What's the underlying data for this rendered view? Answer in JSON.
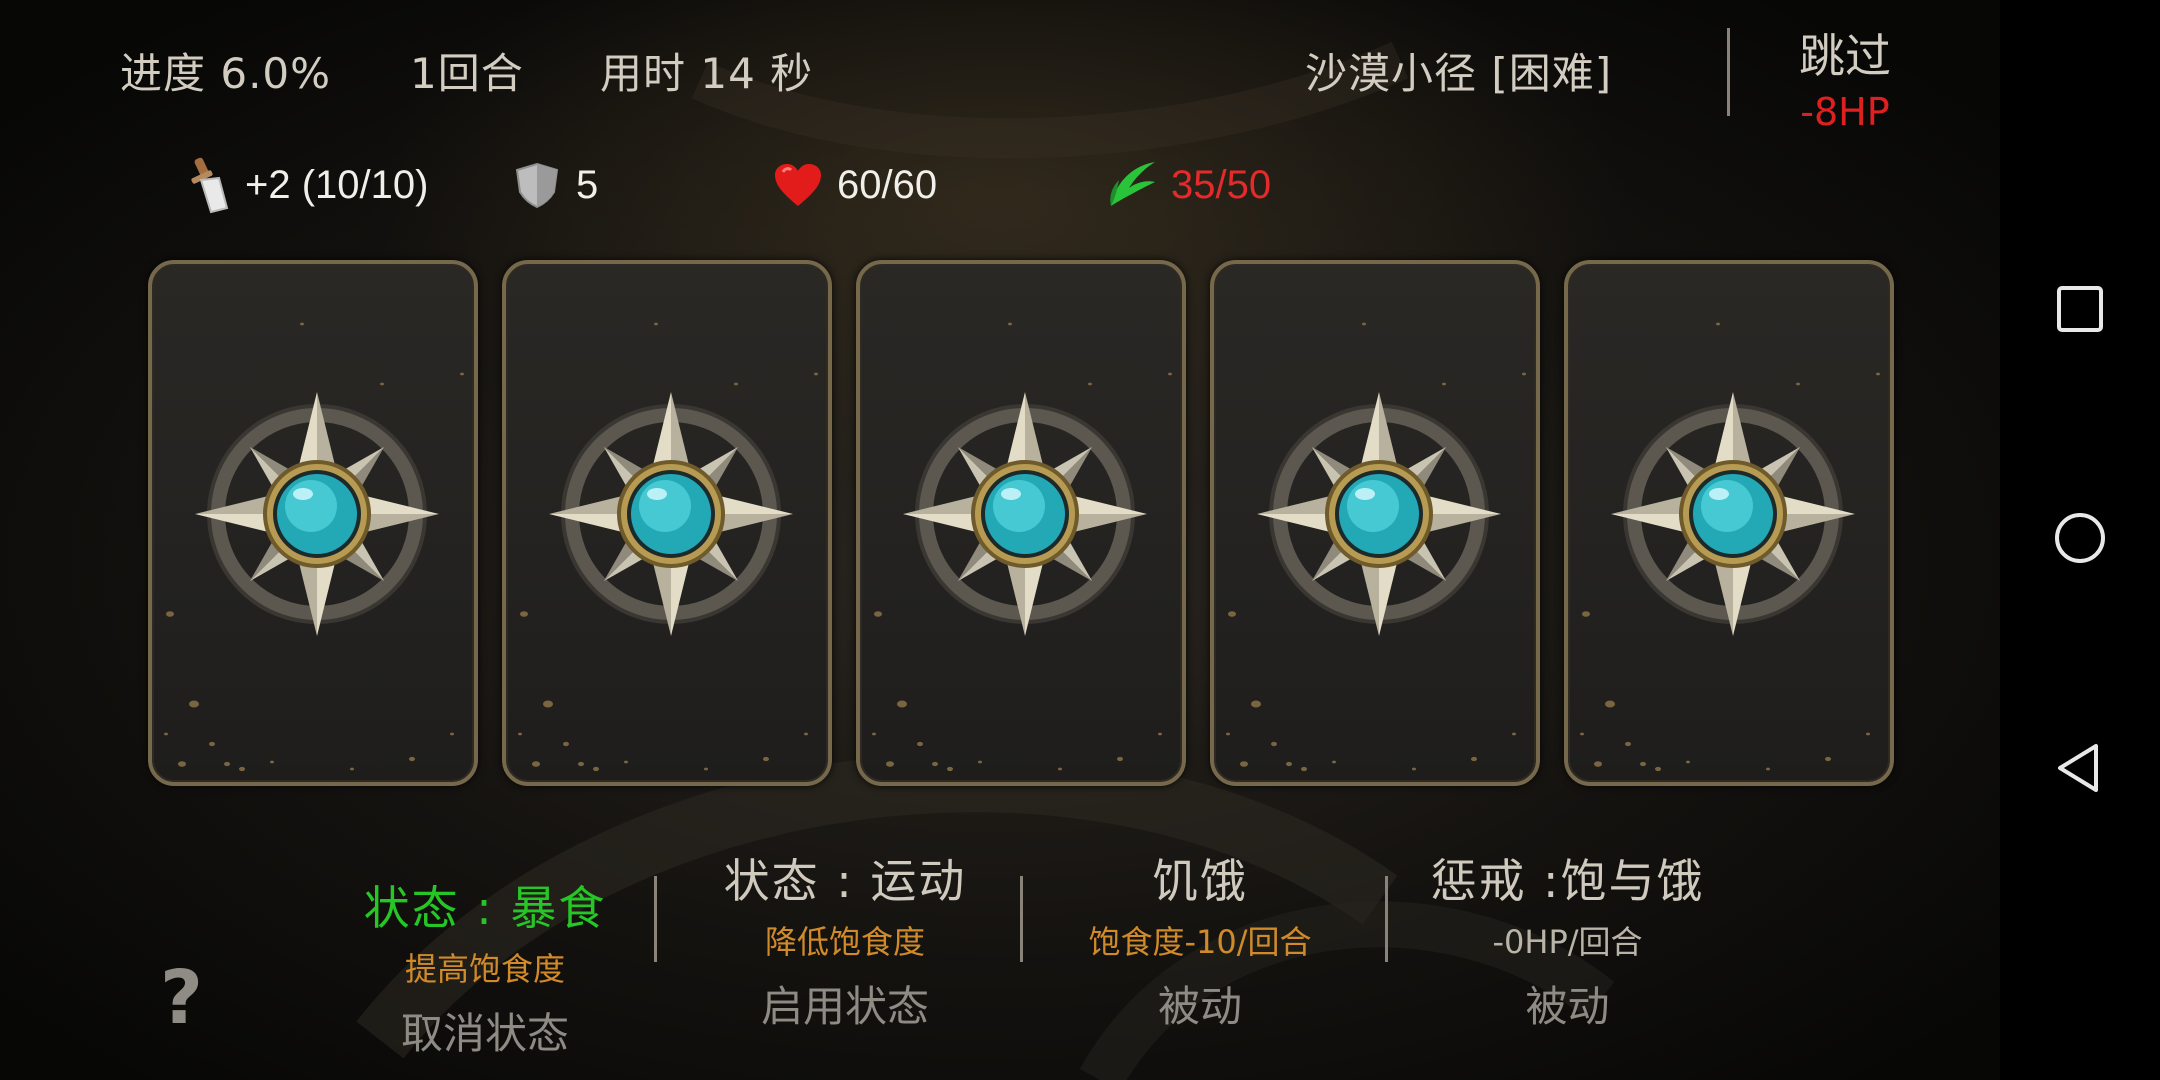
{
  "top_bar": {
    "progress": "进度 6.0%",
    "round": "1回合",
    "time": "用时 14 秒",
    "level": "沙漠小径 [困难]",
    "skip_label": "跳过",
    "skip_cost": "-8HP"
  },
  "stats": {
    "weapon_icon": "sword-icon",
    "weapon": "+2 (10/10)",
    "armor_icon": "shield-icon",
    "armor": "5",
    "health_icon": "heart-icon",
    "health": "60/60",
    "food_icon": "leaf-icon",
    "food": "35/50",
    "food_color": "#e42a2a"
  },
  "cards": [
    {
      "face": "compass-emblem-icon"
    },
    {
      "face": "compass-emblem-icon"
    },
    {
      "face": "compass-emblem-icon"
    },
    {
      "face": "compass-emblem-icon"
    },
    {
      "face": "compass-emblem-icon"
    }
  ],
  "statuses": [
    {
      "title": "状态 : 暴食",
      "desc": "提高饱食度",
      "action": "取消状态",
      "title_color": "#26c626"
    },
    {
      "title": "状态 : 运动",
      "desc": "降低饱食度",
      "action": "启用状态"
    },
    {
      "title": "饥饿",
      "desc": "饱食度-10/回合",
      "action": "被动"
    },
    {
      "title": "惩戒 :饱与饿",
      "desc": "-0HP/回合",
      "action": "被动"
    }
  ],
  "help_label": "?",
  "navbar": {
    "recents": "square-icon",
    "home": "circle-icon",
    "back": "triangle-back-icon"
  }
}
